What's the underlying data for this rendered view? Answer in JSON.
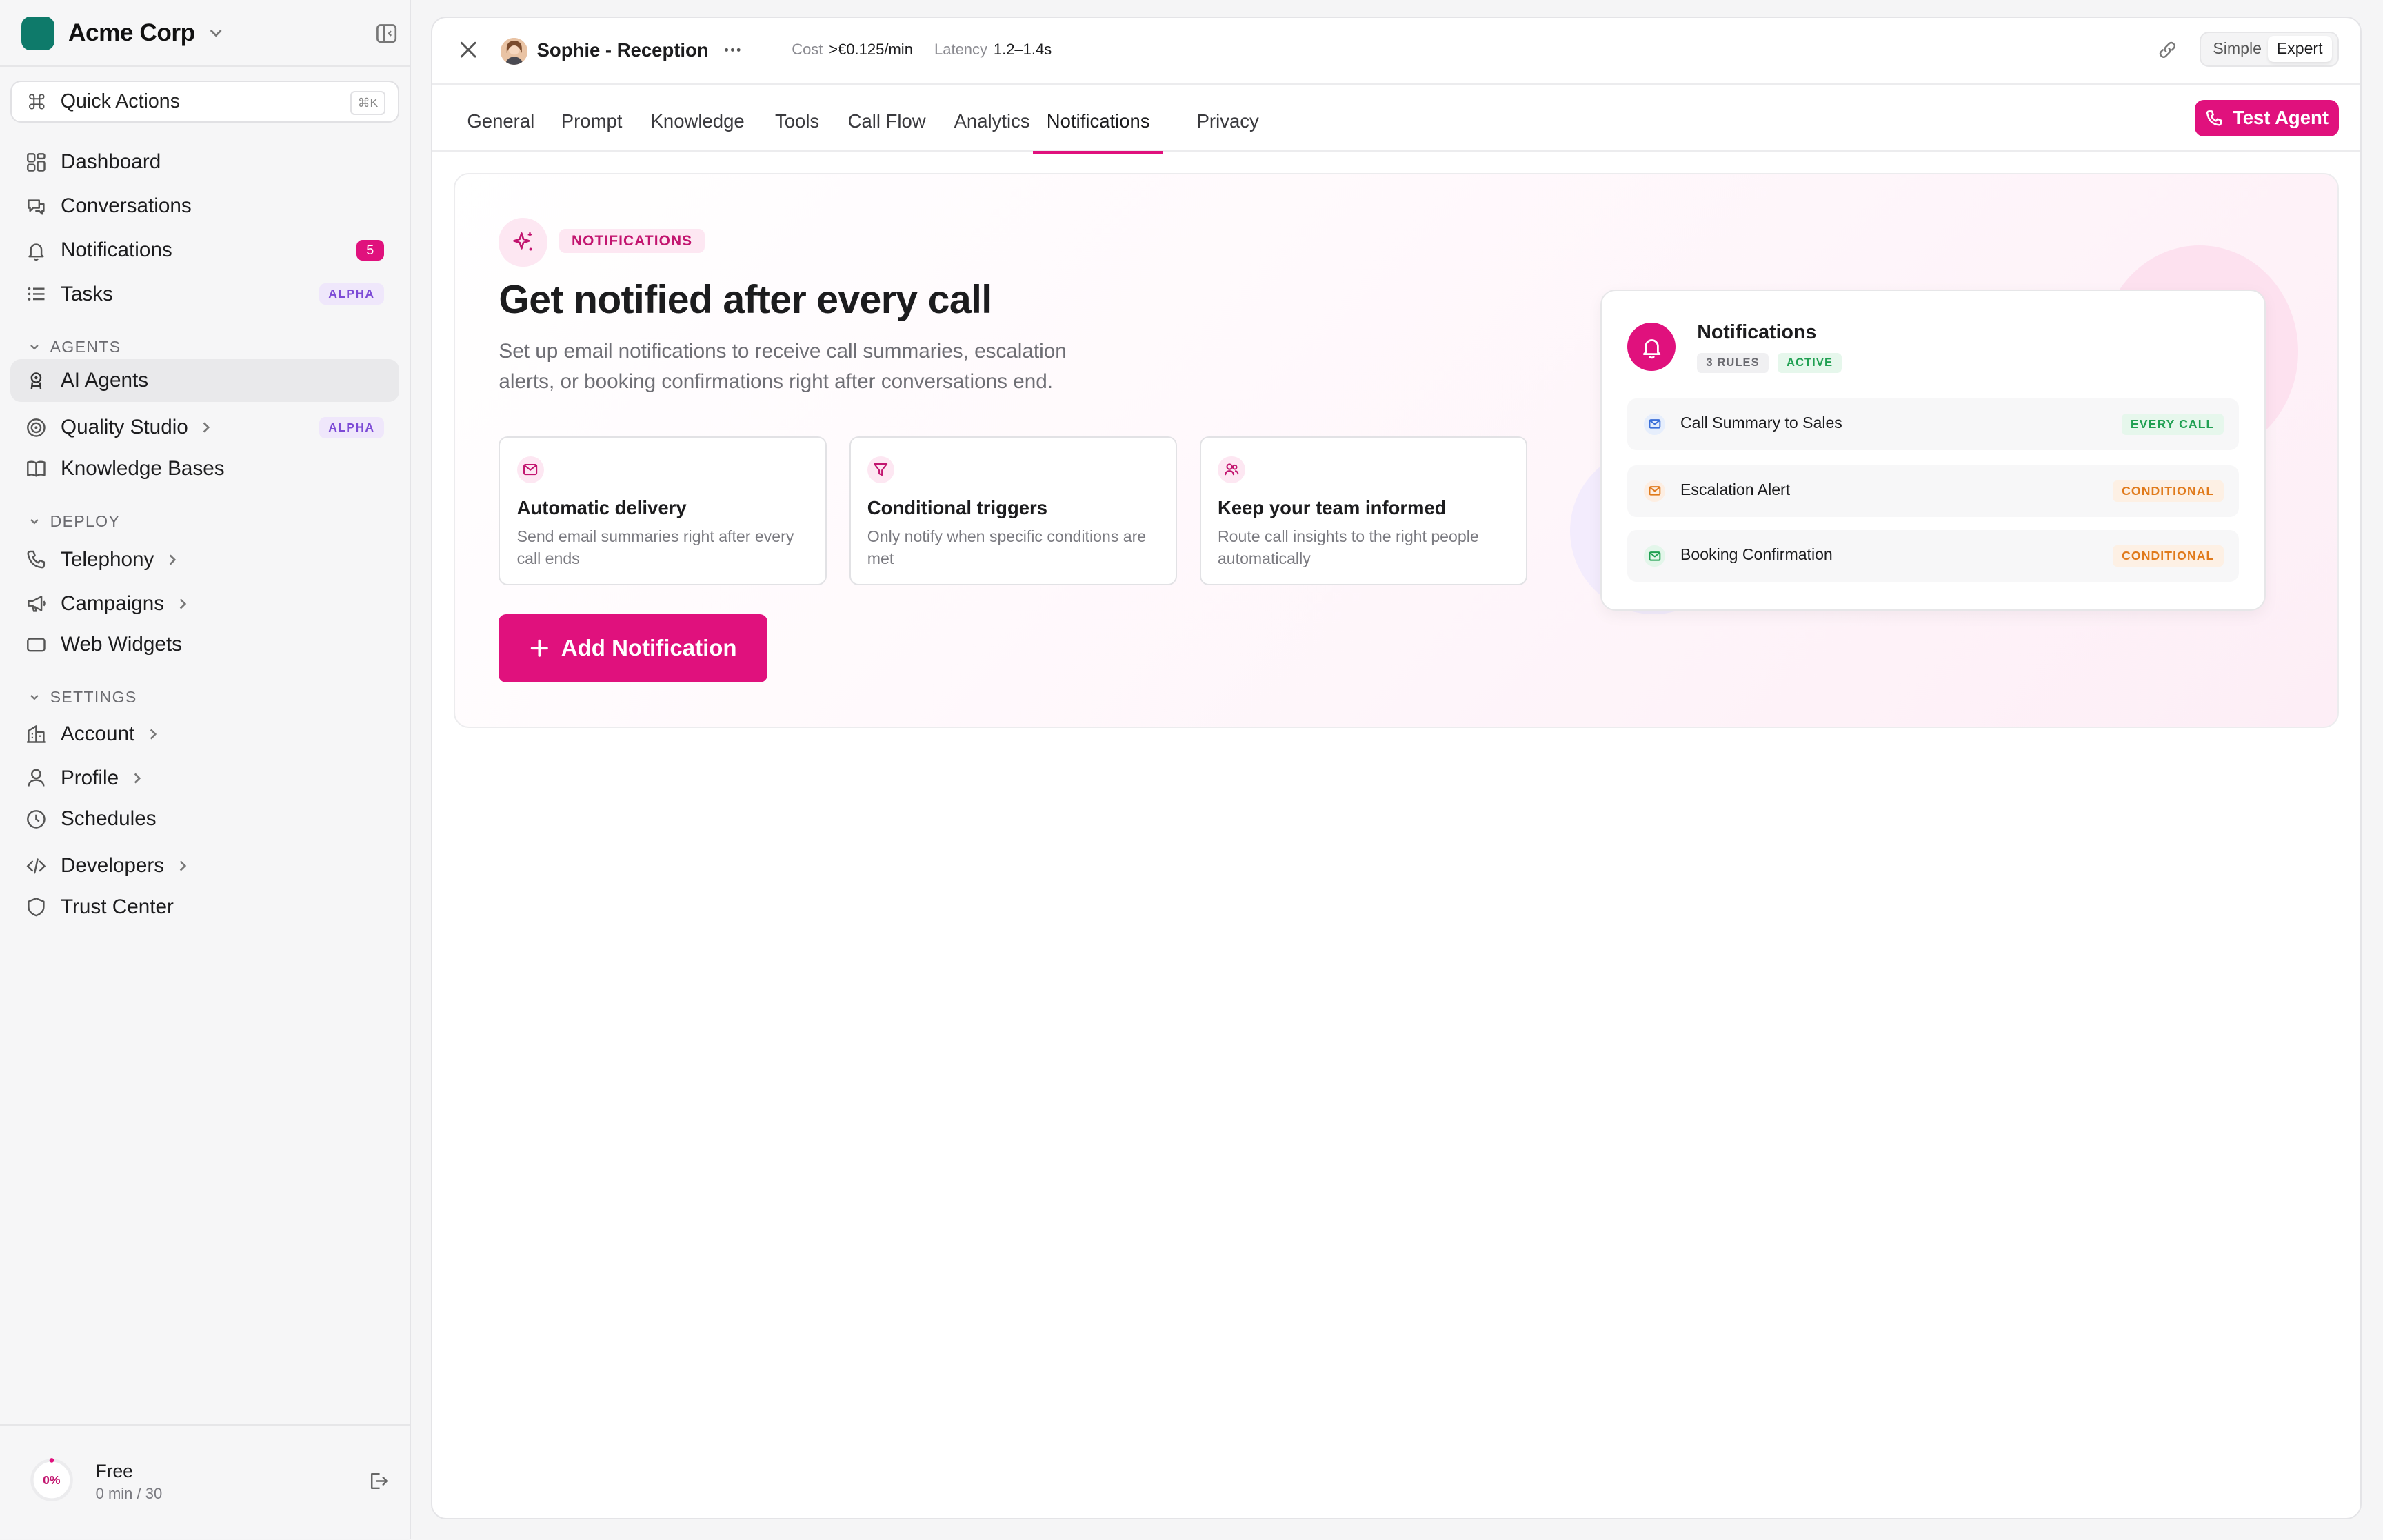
{
  "colors": {
    "accent": "#e0117d",
    "brand": "#0e7a6a",
    "alpha_badge": "#7c4ad6"
  },
  "workspace": {
    "name": "Acme Corp"
  },
  "quick_actions": {
    "label": "Quick Actions",
    "shortcut": "⌘K"
  },
  "nav": {
    "dashboard": "Dashboard",
    "conversations": "Conversations",
    "notifications": "Notifications",
    "notifications_count": "5",
    "tasks": "Tasks",
    "tasks_badge": "ALPHA",
    "agents_heading": "AGENTS",
    "ai_agents": "AI Agents",
    "quality_studio": "Quality Studio",
    "quality_badge": "ALPHA",
    "knowledge_bases": "Knowledge Bases",
    "deploy_heading": "DEPLOY",
    "telephony": "Telephony",
    "campaigns": "Campaigns",
    "web_widgets": "Web Widgets",
    "settings_heading": "SETTINGS",
    "account": "Account",
    "profile": "Profile",
    "schedules": "Schedules",
    "developers": "Developers",
    "trust_center": "Trust Center"
  },
  "usage": {
    "percent_label": "0%",
    "percent_value": 0,
    "plan": "Free",
    "minutes": "0 min / 30"
  },
  "agent": {
    "name": "Sophie - Reception",
    "cost_label": "Cost",
    "cost_value": ">€0.125/min",
    "latency_label": "Latency",
    "latency_value": "1.2–1.4s"
  },
  "mode": {
    "simple": "Simple",
    "expert": "Expert",
    "selected": "Expert"
  },
  "tabs": [
    "General",
    "Prompt",
    "Knowledge",
    "Tools",
    "Call Flow",
    "Analytics",
    "Notifications",
    "Privacy"
  ],
  "active_tab": "Notifications",
  "test_agent": "Test Agent",
  "hero": {
    "eyebrow": "NOTIFICATIONS",
    "title": "Get notified after every call",
    "description": "Set up email notifications to receive call summaries, escalation alerts, or booking confirmations right after conversations end.",
    "features": [
      {
        "title": "Automatic delivery",
        "desc": "Send email summaries right after every call ends",
        "icon": "mail-icon"
      },
      {
        "title": "Conditional triggers",
        "desc": "Only notify when specific conditions are met",
        "icon": "filter-icon"
      },
      {
        "title": "Keep your team informed",
        "desc": "Route call insights to the right people automatically",
        "icon": "users-icon"
      }
    ],
    "add_button": "Add Notification"
  },
  "preview": {
    "title": "Notifications",
    "rules_badge": "3 RULES",
    "status_badge": "ACTIVE",
    "rules": [
      {
        "name": "Call Summary to Sales",
        "trigger": "EVERY CALL"
      },
      {
        "name": "Escalation Alert",
        "trigger": "CONDITIONAL"
      },
      {
        "name": "Booking Confirmation",
        "trigger": "CONDITIONAL"
      }
    ]
  }
}
